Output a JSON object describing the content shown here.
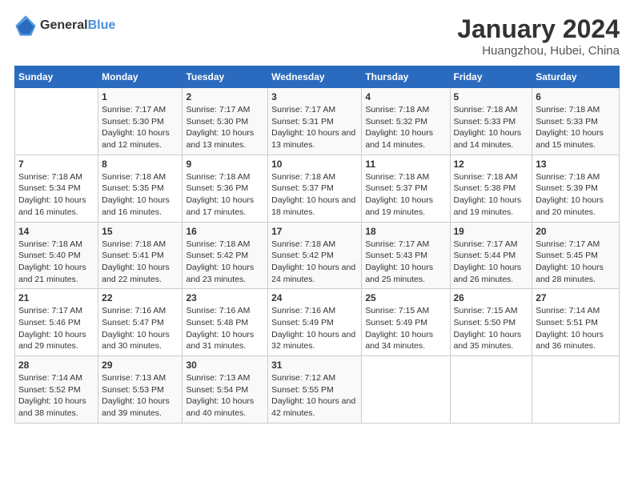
{
  "logo": {
    "general": "General",
    "blue": "Blue"
  },
  "title": "January 2024",
  "subtitle": "Huangzhou, Hubei, China",
  "columns": [
    "Sunday",
    "Monday",
    "Tuesday",
    "Wednesday",
    "Thursday",
    "Friday",
    "Saturday"
  ],
  "weeks": [
    [
      {
        "day": "",
        "sunrise": "",
        "sunset": "",
        "daylight": ""
      },
      {
        "day": "1",
        "sunrise": "Sunrise: 7:17 AM",
        "sunset": "Sunset: 5:30 PM",
        "daylight": "Daylight: 10 hours and 12 minutes."
      },
      {
        "day": "2",
        "sunrise": "Sunrise: 7:17 AM",
        "sunset": "Sunset: 5:30 PM",
        "daylight": "Daylight: 10 hours and 13 minutes."
      },
      {
        "day": "3",
        "sunrise": "Sunrise: 7:17 AM",
        "sunset": "Sunset: 5:31 PM",
        "daylight": "Daylight: 10 hours and 13 minutes."
      },
      {
        "day": "4",
        "sunrise": "Sunrise: 7:18 AM",
        "sunset": "Sunset: 5:32 PM",
        "daylight": "Daylight: 10 hours and 14 minutes."
      },
      {
        "day": "5",
        "sunrise": "Sunrise: 7:18 AM",
        "sunset": "Sunset: 5:33 PM",
        "daylight": "Daylight: 10 hours and 14 minutes."
      },
      {
        "day": "6",
        "sunrise": "Sunrise: 7:18 AM",
        "sunset": "Sunset: 5:33 PM",
        "daylight": "Daylight: 10 hours and 15 minutes."
      }
    ],
    [
      {
        "day": "7",
        "sunrise": "Sunrise: 7:18 AM",
        "sunset": "Sunset: 5:34 PM",
        "daylight": "Daylight: 10 hours and 16 minutes."
      },
      {
        "day": "8",
        "sunrise": "Sunrise: 7:18 AM",
        "sunset": "Sunset: 5:35 PM",
        "daylight": "Daylight: 10 hours and 16 minutes."
      },
      {
        "day": "9",
        "sunrise": "Sunrise: 7:18 AM",
        "sunset": "Sunset: 5:36 PM",
        "daylight": "Daylight: 10 hours and 17 minutes."
      },
      {
        "day": "10",
        "sunrise": "Sunrise: 7:18 AM",
        "sunset": "Sunset: 5:37 PM",
        "daylight": "Daylight: 10 hours and 18 minutes."
      },
      {
        "day": "11",
        "sunrise": "Sunrise: 7:18 AM",
        "sunset": "Sunset: 5:37 PM",
        "daylight": "Daylight: 10 hours and 19 minutes."
      },
      {
        "day": "12",
        "sunrise": "Sunrise: 7:18 AM",
        "sunset": "Sunset: 5:38 PM",
        "daylight": "Daylight: 10 hours and 19 minutes."
      },
      {
        "day": "13",
        "sunrise": "Sunrise: 7:18 AM",
        "sunset": "Sunset: 5:39 PM",
        "daylight": "Daylight: 10 hours and 20 minutes."
      }
    ],
    [
      {
        "day": "14",
        "sunrise": "Sunrise: 7:18 AM",
        "sunset": "Sunset: 5:40 PM",
        "daylight": "Daylight: 10 hours and 21 minutes."
      },
      {
        "day": "15",
        "sunrise": "Sunrise: 7:18 AM",
        "sunset": "Sunset: 5:41 PM",
        "daylight": "Daylight: 10 hours and 22 minutes."
      },
      {
        "day": "16",
        "sunrise": "Sunrise: 7:18 AM",
        "sunset": "Sunset: 5:42 PM",
        "daylight": "Daylight: 10 hours and 23 minutes."
      },
      {
        "day": "17",
        "sunrise": "Sunrise: 7:18 AM",
        "sunset": "Sunset: 5:42 PM",
        "daylight": "Daylight: 10 hours and 24 minutes."
      },
      {
        "day": "18",
        "sunrise": "Sunrise: 7:17 AM",
        "sunset": "Sunset: 5:43 PM",
        "daylight": "Daylight: 10 hours and 25 minutes."
      },
      {
        "day": "19",
        "sunrise": "Sunrise: 7:17 AM",
        "sunset": "Sunset: 5:44 PM",
        "daylight": "Daylight: 10 hours and 26 minutes."
      },
      {
        "day": "20",
        "sunrise": "Sunrise: 7:17 AM",
        "sunset": "Sunset: 5:45 PM",
        "daylight": "Daylight: 10 hours and 28 minutes."
      }
    ],
    [
      {
        "day": "21",
        "sunrise": "Sunrise: 7:17 AM",
        "sunset": "Sunset: 5:46 PM",
        "daylight": "Daylight: 10 hours and 29 minutes."
      },
      {
        "day": "22",
        "sunrise": "Sunrise: 7:16 AM",
        "sunset": "Sunset: 5:47 PM",
        "daylight": "Daylight: 10 hours and 30 minutes."
      },
      {
        "day": "23",
        "sunrise": "Sunrise: 7:16 AM",
        "sunset": "Sunset: 5:48 PM",
        "daylight": "Daylight: 10 hours and 31 minutes."
      },
      {
        "day": "24",
        "sunrise": "Sunrise: 7:16 AM",
        "sunset": "Sunset: 5:49 PM",
        "daylight": "Daylight: 10 hours and 32 minutes."
      },
      {
        "day": "25",
        "sunrise": "Sunrise: 7:15 AM",
        "sunset": "Sunset: 5:49 PM",
        "daylight": "Daylight: 10 hours and 34 minutes."
      },
      {
        "day": "26",
        "sunrise": "Sunrise: 7:15 AM",
        "sunset": "Sunset: 5:50 PM",
        "daylight": "Daylight: 10 hours and 35 minutes."
      },
      {
        "day": "27",
        "sunrise": "Sunrise: 7:14 AM",
        "sunset": "Sunset: 5:51 PM",
        "daylight": "Daylight: 10 hours and 36 minutes."
      }
    ],
    [
      {
        "day": "28",
        "sunrise": "Sunrise: 7:14 AM",
        "sunset": "Sunset: 5:52 PM",
        "daylight": "Daylight: 10 hours and 38 minutes."
      },
      {
        "day": "29",
        "sunrise": "Sunrise: 7:13 AM",
        "sunset": "Sunset: 5:53 PM",
        "daylight": "Daylight: 10 hours and 39 minutes."
      },
      {
        "day": "30",
        "sunrise": "Sunrise: 7:13 AM",
        "sunset": "Sunset: 5:54 PM",
        "daylight": "Daylight: 10 hours and 40 minutes."
      },
      {
        "day": "31",
        "sunrise": "Sunrise: 7:12 AM",
        "sunset": "Sunset: 5:55 PM",
        "daylight": "Daylight: 10 hours and 42 minutes."
      },
      {
        "day": "",
        "sunrise": "",
        "sunset": "",
        "daylight": ""
      },
      {
        "day": "",
        "sunrise": "",
        "sunset": "",
        "daylight": ""
      },
      {
        "day": "",
        "sunrise": "",
        "sunset": "",
        "daylight": ""
      }
    ]
  ]
}
